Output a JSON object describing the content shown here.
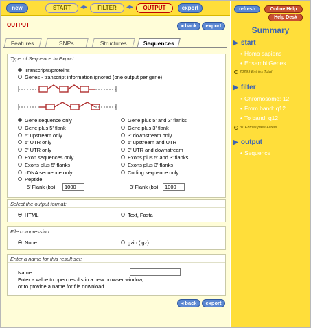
{
  "nav": {
    "new": "new",
    "start": "START",
    "filter": "FILTER",
    "output": "OUTPUT",
    "export": "export"
  },
  "main": {
    "title": "OUTPUT",
    "back": "back",
    "export": "export",
    "tabs": [
      "Features",
      "SNPs",
      "Structures",
      "Sequences"
    ]
  },
  "sequence_type": {
    "heading": "Type of Sequence to Export:",
    "modes": [
      "Transcripts/proteins",
      "Genes - transcript information ignored (one output per gene)"
    ],
    "left_options": [
      "Gene sequence only",
      "Gene plus 5' flank",
      "5' upstream only",
      "5' UTR only",
      "3' UTR only",
      "Exon sequences only",
      "Exons plus 5' flanks",
      "cDNA sequence only",
      "Peptide"
    ],
    "right_options": [
      "Gene plus 5' and 3' flanks",
      "Gene plus 3' flank",
      "3' downstream only",
      "5' upstream and UTR",
      "3' UTR and downstream",
      "Exons plus 5' and 3' flanks",
      "Exons plus 3' flanks",
      "Coding sequence only"
    ],
    "flank5_label": "5' Flank (bp)",
    "flank5_value": "1000",
    "flank3_label": "3' Flank (bp)",
    "flank3_value": "1000"
  },
  "format": {
    "heading": "Select the output format:",
    "html": "HTML",
    "text": "Text, Fasta"
  },
  "compression": {
    "heading": "File compression:",
    "none": "None",
    "gzip": "gzip (.gz)"
  },
  "result_name": {
    "heading": "Enter a name for this result set:",
    "label": "Name:",
    "value": "",
    "help1": "Enter a value to open results in a new browser window,",
    "help2": "or to provide a name for file download."
  },
  "sidebar": {
    "refresh": "refresh",
    "online_help": "Online Help",
    "help_desk": "Help Desk",
    "summary": "Summary",
    "start_label": "start",
    "start_items": [
      "Homo sapiens",
      "Ensembl Genes"
    ],
    "start_note": "23299 Entries Total",
    "filter_label": "filter",
    "filter_items": [
      "Chromosome: 12",
      "From band: q12",
      "To band: q12"
    ],
    "filter_note": "31 Entries pass Filters",
    "output_label": "output",
    "output_items": [
      "Sequence"
    ]
  },
  "colors": {
    "nav_yellow": "#ffde3a",
    "panel_cream": "#fffdd8",
    "link_blue": "#3b63b4",
    "accent_red": "#c00000",
    "diagram_red": "#b03030"
  }
}
